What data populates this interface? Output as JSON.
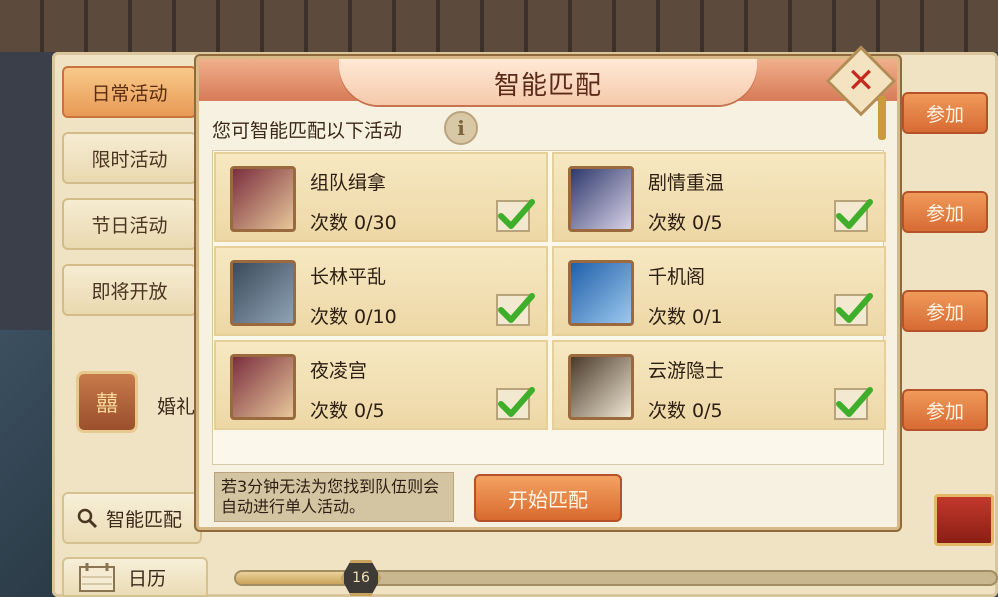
{
  "sidebar": {
    "tabs": [
      {
        "label": "日常活动",
        "active": true
      },
      {
        "label": "限时活动",
        "active": false
      },
      {
        "label": "节日活动",
        "active": false
      },
      {
        "label": "即将开放",
        "active": false
      }
    ],
    "wedding_label": "婚礼",
    "wedding_icon": "囍",
    "smart_match_label": "智能匹配",
    "calendar_label": "日历"
  },
  "right_buttons": [
    "参加",
    "参加",
    "参加",
    "参加"
  ],
  "progress": {
    "value": 16,
    "fill_fraction": 0.17
  },
  "dialog": {
    "title": "智能匹配",
    "subtitle": "您可智能匹配以下活动",
    "info_icon": "i",
    "close_icon": "✕",
    "activities": [
      {
        "name": "组队缉拿",
        "count": "次数 0/30",
        "checked": true,
        "icon": "scroll-icon"
      },
      {
        "name": "剧情重温",
        "count": "次数 0/5",
        "checked": true,
        "icon": "book-icon"
      },
      {
        "name": "长林平乱",
        "count": "次数 0/10",
        "checked": true,
        "icon": "token-icon"
      },
      {
        "name": "千机阁",
        "count": "次数 0/1",
        "checked": true,
        "icon": "blue-book-icon"
      },
      {
        "name": "夜凌宫",
        "count": "次数 0/5",
        "checked": true,
        "icon": "scroll-icon"
      },
      {
        "name": "云游隐士",
        "count": "次数 0/5",
        "checked": true,
        "icon": "open-book-icon"
      }
    ],
    "notice": "若3分钟无法为您找到队伍则会自动进行单人活动。",
    "start_button": "开始匹配"
  },
  "colors": {
    "accent": "#d96a2e",
    "check": "#3fae2a",
    "close": "#c52a1e"
  }
}
